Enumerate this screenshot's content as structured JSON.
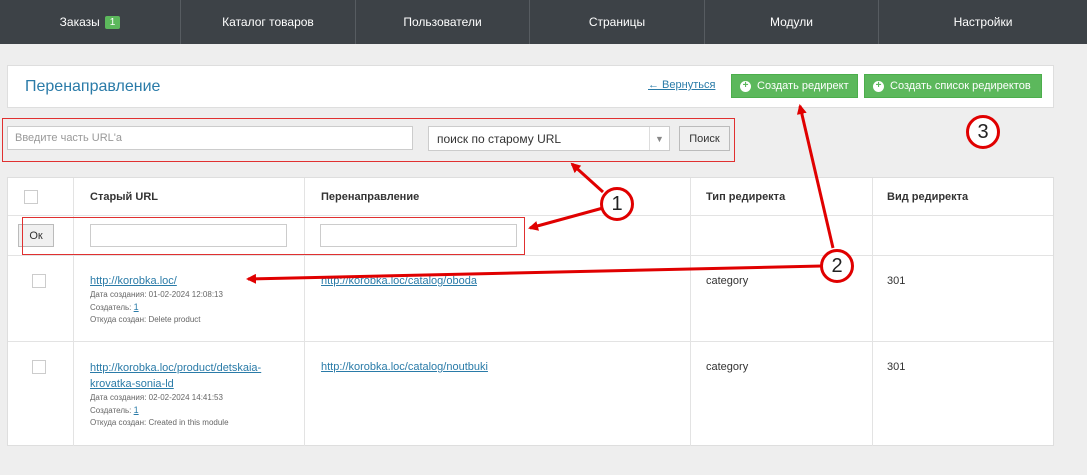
{
  "nav": {
    "items": [
      {
        "label": "Заказы",
        "badge": "1"
      },
      {
        "label": "Каталог товаров"
      },
      {
        "label": "Пользователи"
      },
      {
        "label": "Страницы"
      },
      {
        "label": "Модули"
      },
      {
        "label": "Настройки"
      }
    ]
  },
  "header": {
    "title": "Перенаправление",
    "back_link": "← Вернуться",
    "create_redirect": "Создать редирект",
    "create_redirect_list": "Создать список редиректов"
  },
  "search": {
    "placeholder": "Введите часть URL'a",
    "select_value": "поиск по старому URL",
    "button": "Поиск"
  },
  "table": {
    "headers": {
      "old_url": "Старый URL",
      "redirect": "Перенаправление",
      "type": "Тип редиректа",
      "kind": "Вид редиректа"
    },
    "ok_button": "Ок",
    "rows": [
      {
        "old_url": "http://korobka.loc/",
        "created": "Дата создания: 01-02-2024 12:08:13",
        "creator_label": "Создатель:",
        "creator": "1",
        "origin": "Откуда создан: Delete product",
        "redirect": "http://korobka.loc/catalog/oboda",
        "type": "category",
        "kind": "301"
      },
      {
        "old_url_line1": "http://korobka.loc/product/detskaia-",
        "old_url_line2": "krovatka-sonia-ld",
        "created": "Дата создания: 02-02-2024 14:41:53",
        "creator_label": "Создатель:",
        "creator": "1",
        "origin": "Откуда создан: Created in this module",
        "redirect": "http://korobka.loc/catalog/noutbuki",
        "type": "category",
        "kind": "301"
      }
    ]
  },
  "annotations": {
    "markers": [
      "1",
      "2",
      "3"
    ],
    "color": "#e00000"
  }
}
